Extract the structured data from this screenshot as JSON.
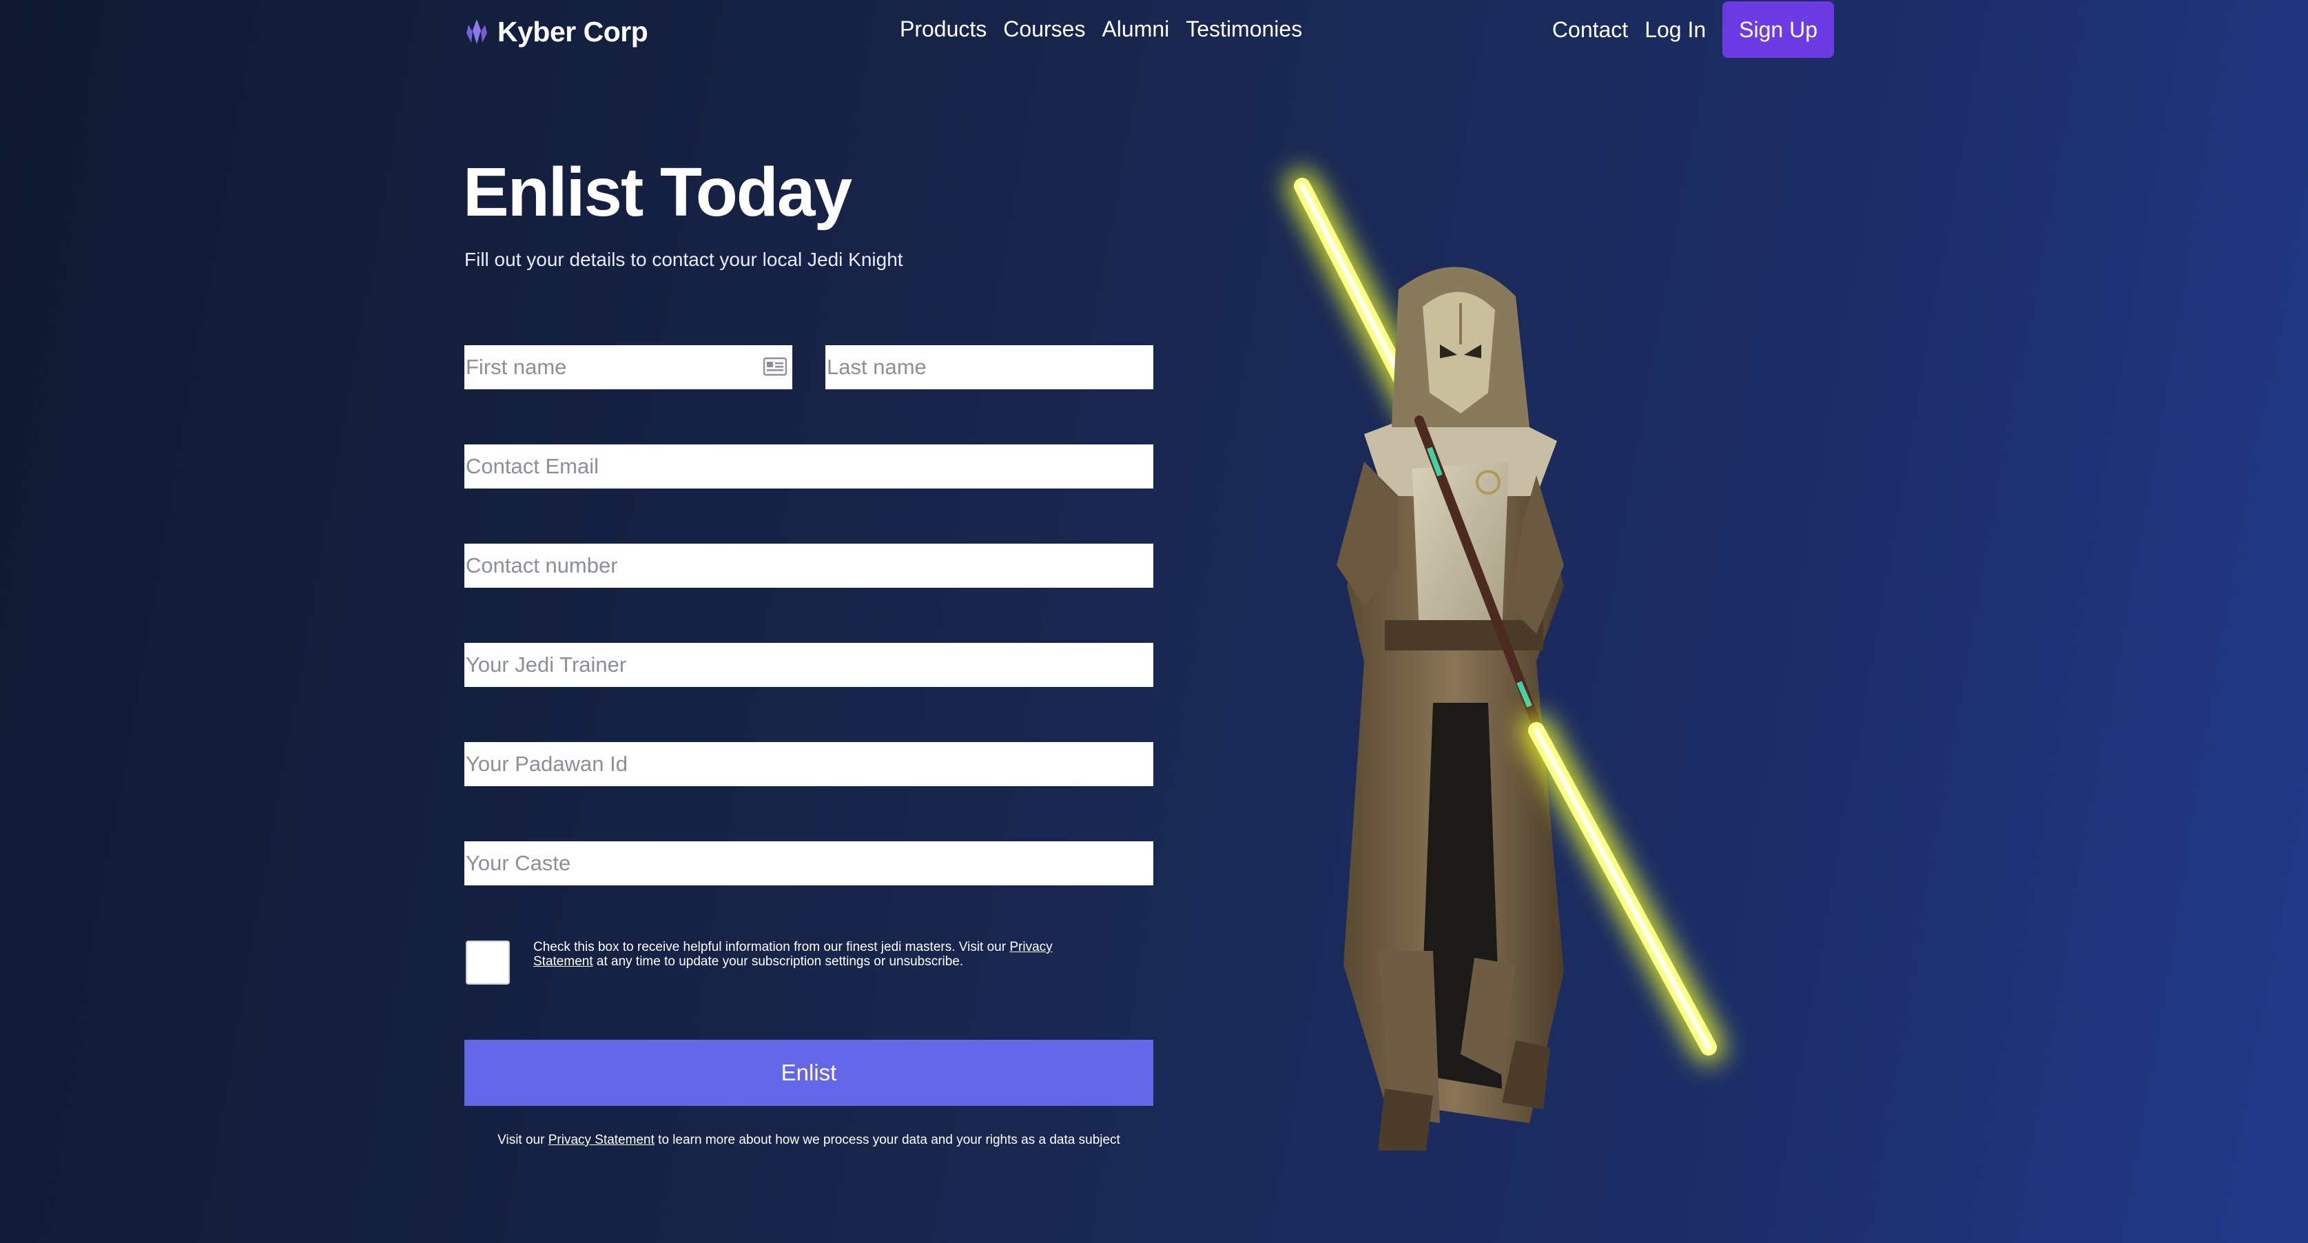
{
  "brand": {
    "name": "Kyber Corp",
    "icon": "kyber-crystal-icon"
  },
  "nav": {
    "links": [
      "Products",
      "Courses",
      "Alumni",
      "Testimonies"
    ],
    "contact": "Contact",
    "login": "Log In",
    "signup": "Sign Up"
  },
  "hero": {
    "title": "Enlist Today",
    "subtitle": "Fill out your details to contact your local Jedi Knight"
  },
  "form": {
    "first_name_placeholder": "First name",
    "last_name_placeholder": "Last name",
    "email_placeholder": "Contact Email",
    "phone_placeholder": "Contact number",
    "trainer_placeholder": "Your Jedi Trainer",
    "padawan_placeholder": "Your Padawan Id",
    "caste_placeholder": "Your Caste",
    "consent_before": "Check this box to receive helpful information from our finest jedi masters. Visit our ",
    "consent_link": "Privacy Statement",
    "consent_after": " at any time to update your subscription settings or unsubscribe.",
    "submit": "Enlist",
    "footnote_before": "Visit our ",
    "footnote_link": "Privacy Statement",
    "footnote_after": " to learn more about how we process your data and your rights as a data subject"
  },
  "colors": {
    "accent_button": "#6d3be3",
    "submit_button": "#6366e6",
    "lightsaber": "#f5ff4a"
  }
}
